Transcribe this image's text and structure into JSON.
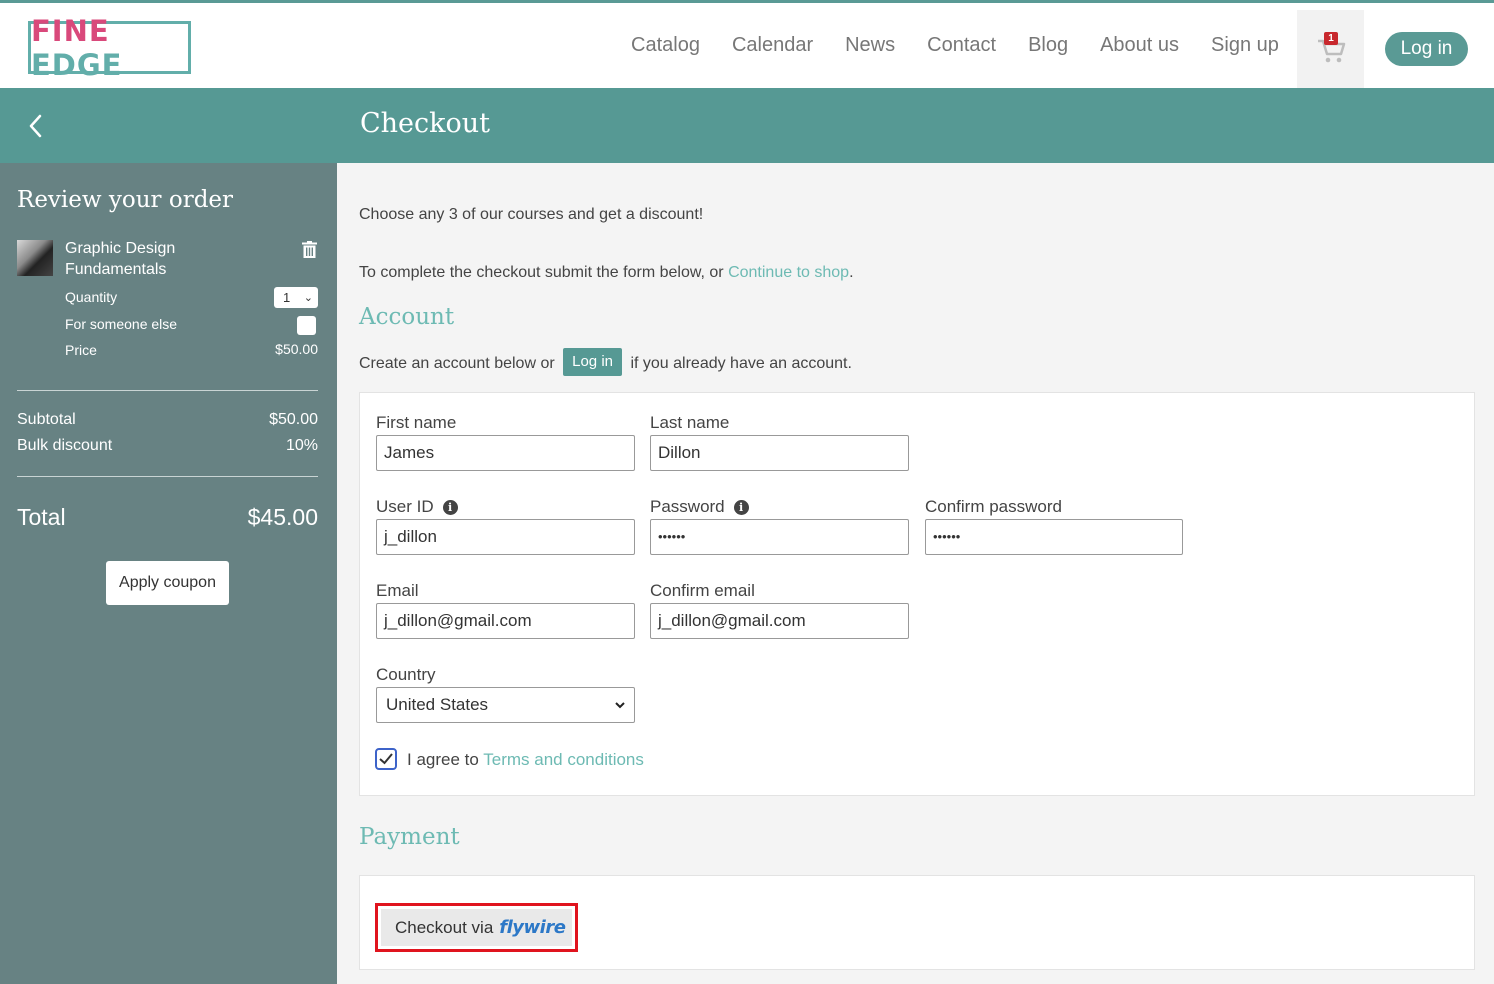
{
  "brand": {
    "part1": "FINE",
    "part2": "EDGE",
    "color_pink": "#d9497b",
    "color_teal": "#62aeaa"
  },
  "nav": {
    "items": [
      "Catalog",
      "Calendar",
      "News",
      "Contact",
      "Blog",
      "About us",
      "Sign up"
    ],
    "cart_count": "1",
    "cart_icon": "cart-icon",
    "login_label": "Log in"
  },
  "header": {
    "title": "Checkout",
    "back_icon": "chevron-left-icon"
  },
  "sidebar": {
    "title": "Review your order",
    "item": {
      "name": "Graphic Design Fundamentals",
      "quantity_label": "Quantity",
      "quantity_value": "1",
      "someone_else_label": "For someone else",
      "price_label": "Price",
      "price_value": "$50.00"
    },
    "subtotal_label": "Subtotal",
    "subtotal_value": "$50.00",
    "discount_label": "Bulk discount",
    "discount_value": "10%",
    "total_label": "Total",
    "total_value": "$45.00",
    "coupon_label": "Apply coupon"
  },
  "main": {
    "promo": "Choose any 3 of our courses and get a discount!",
    "intro_prefix": "To complete the checkout submit the form below, or ",
    "intro_link": "Continue to shop",
    "intro_suffix": ".",
    "account_title": "Account",
    "account_prefix": "Create an account below or ",
    "account_login": "Log in",
    "account_suffix": " if you already have an account.",
    "form": {
      "first_name_label": "First name",
      "first_name_value": "James",
      "last_name_label": "Last name",
      "last_name_value": "Dillon",
      "user_id_label": "User ID",
      "user_id_value": "j_dillon",
      "password_label": "Password",
      "password_value": "••••••",
      "confirm_password_label": "Confirm password",
      "confirm_password_value": "••••••",
      "email_label": "Email",
      "email_value": "j_dillon@gmail.com",
      "confirm_email_label": "Confirm email",
      "confirm_email_value": "j_dillon@gmail.com",
      "country_label": "Country",
      "country_value": "United States",
      "agree_prefix": "I agree to ",
      "agree_link": "Terms and conditions",
      "agree_checked": true
    },
    "payment_title": "Payment",
    "payment_button_text": "Checkout via",
    "payment_provider": "flywire"
  },
  "colors": {
    "accent": "#569994",
    "link": "#6dbab3",
    "highlight": "#e0141e"
  }
}
